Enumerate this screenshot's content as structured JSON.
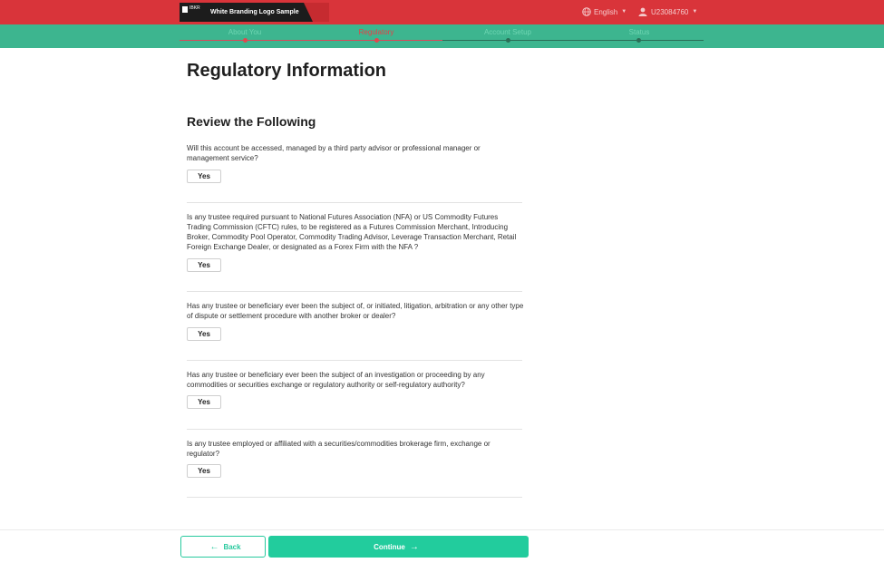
{
  "header": {
    "logo_small_text": "IBKR",
    "logo_text": "White Branding Logo Sample",
    "language": "English",
    "username": "U23084760",
    "bg_color": "#d9343a"
  },
  "steps": [
    {
      "label": "About You",
      "state": "done"
    },
    {
      "label": "Regulatory",
      "state": "active"
    },
    {
      "label": "Account Setup",
      "state": "pending"
    },
    {
      "label": "Status",
      "state": "pending"
    }
  ],
  "page_title": "Regulatory Information",
  "section_title": "Review the Following",
  "questions": [
    {
      "text": "Will this account be accessed, managed by a third party advisor or professional manager or management service?",
      "answer": "Yes"
    },
    {
      "text": "Is any trustee required pursuant to National Futures Association (NFA) or US Commodity Futures Trading Commission (CFTC) rules, to be registered as a Futures Commission Merchant, Introducing Broker, Commodity Pool Operator, Commodity Trading Advisor, Leverage Transaction Merchant, Retail Foreign Exchange Dealer, or designated as a Forex Firm with the NFA ?",
      "answer": "Yes"
    },
    {
      "text": "Has any trustee or beneficiary ever been the subject of, or initiated, litigation, arbitration or any other type of dispute or settlement procedure with another broker or dealer?",
      "answer": "Yes"
    },
    {
      "text": "Has any trustee or beneficiary ever been the subject of an investigation or proceeding by any commodities or securities exchange or regulatory authority or self-regulatory authority?",
      "answer": "Yes"
    },
    {
      "text": "Is any trustee employed or affiliated with a securities/commodities brokerage firm, exchange or regulator?",
      "answer": "Yes"
    }
  ],
  "footer": {
    "back_label": "Back",
    "continue_label": "Continue",
    "accent_color": "#22cc9d"
  }
}
